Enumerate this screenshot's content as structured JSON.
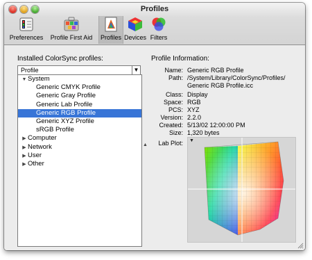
{
  "window": {
    "title": "Profiles"
  },
  "toolbar": {
    "items": [
      {
        "label": "Preferences",
        "icon": "preferences-icon"
      },
      {
        "label": "Profile First Aid",
        "icon": "first-aid-icon"
      },
      {
        "label": "Profiles",
        "icon": "profiles-icon",
        "selected": true
      },
      {
        "label": "Devices",
        "icon": "devices-icon"
      },
      {
        "label": "Filters",
        "icon": "filters-icon"
      }
    ]
  },
  "profiles_panel": {
    "heading": "Installed ColorSync profiles:",
    "sort_popup": "Profile",
    "groups": [
      {
        "label": "System",
        "expanded": true,
        "items": [
          "Generic CMYK Profile",
          "Generic Gray Profile",
          "Generic Lab Profile",
          "Generic RGB Profile",
          "Generic XYZ Profile",
          "sRGB Profile"
        ]
      },
      {
        "label": "Computer",
        "expanded": false
      },
      {
        "label": "Network",
        "expanded": false
      },
      {
        "label": "User",
        "expanded": false
      },
      {
        "label": "Other",
        "expanded": false
      }
    ],
    "selected": "Generic RGB Profile"
  },
  "info": {
    "heading": "Profile Information:",
    "name_label": "Name:",
    "name": "Generic RGB Profile",
    "path_label": "Path:",
    "path_line1": "/System/Library/ColorSync/Profiles/",
    "path_line2": "Generic RGB Profile.icc",
    "class_label": "Class:",
    "class": "Display",
    "space_label": "Space:",
    "space": "RGB",
    "pcs_label": "PCS:",
    "pcs": "XYZ",
    "version_label": "Version:",
    "version": "2.2.0",
    "created_label": "Created:",
    "created": "5/13/02 12:00:00 PM",
    "size_label": "Size:",
    "size": "1,320 bytes",
    "lab_plot_label": "Lab Plot:"
  },
  "colors": {
    "selection": "#3875d7",
    "window_bg": "#ececec"
  }
}
